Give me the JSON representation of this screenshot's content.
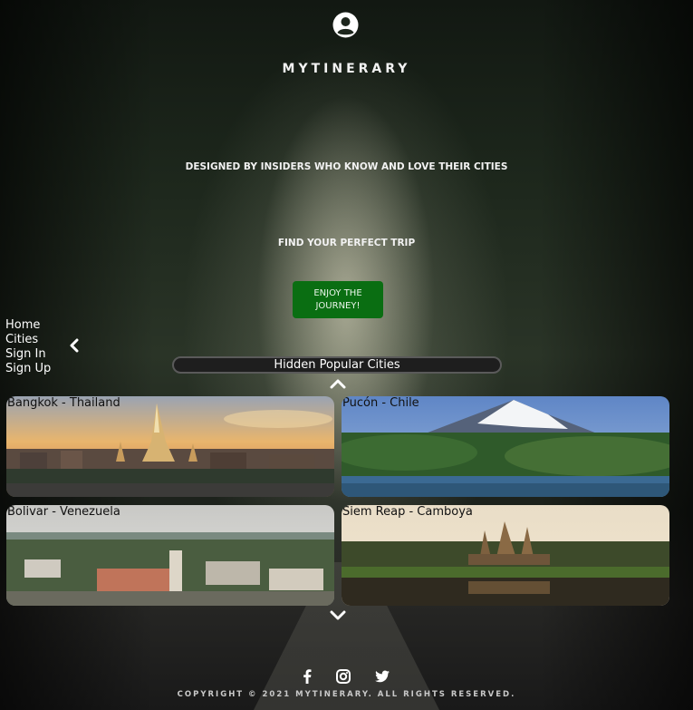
{
  "header": {
    "logo": "MYTINERARY",
    "tagline": "DESIGNED BY INSIDERS WHO KNOW AND LOVE THEIR CITIES",
    "subtagline": "FIND YOUR PERFECT TRIP",
    "cta_label": "ENJOY THE JOURNEY!",
    "user_icon": "user-circle-icon"
  },
  "nav": {
    "items": [
      "Home",
      "Cities",
      "Sign In",
      "Sign Up"
    ]
  },
  "carousel": {
    "title": "Hidden Popular Cities",
    "cities": [
      {
        "label": "Bangkok - Thailand"
      },
      {
        "label": "Pucón - Chile"
      },
      {
        "label": "Bolivar - Venezuela"
      },
      {
        "label": "Siem Reap - Camboya"
      }
    ]
  },
  "footer": {
    "social": [
      "facebook-icon",
      "instagram-icon",
      "twitter-icon"
    ],
    "copyright": "COPYRIGHT © 2021 MYTINERARY. ALL RIGHTS RESERVED."
  },
  "colors": {
    "cta_background": "#0a6e12",
    "text": "#ffffff"
  }
}
